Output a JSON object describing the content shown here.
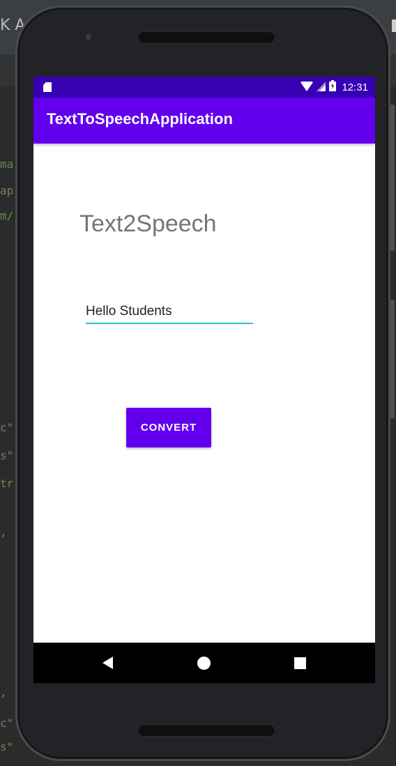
{
  "ide": {
    "top_text": "K A",
    "code_fragments": [
      "ma",
      "ap",
      "m/",
      "c\"",
      "s\"",
      "tr",
      ",",
      ",",
      "c\"",
      "s\""
    ]
  },
  "status_bar": {
    "time": "12:31",
    "icons": [
      "sd-card-icon",
      "wifi-icon",
      "signal-icon",
      "battery-icon"
    ]
  },
  "app_bar": {
    "title": "TextToSpeechApplication"
  },
  "main": {
    "heading": "Text2Speech",
    "input_value": "Hello Students",
    "convert_label": "CONVERT"
  },
  "nav_bar": {
    "icons": [
      "back-icon",
      "home-icon",
      "recent-apps-icon"
    ]
  },
  "colors": {
    "status_bar": "#3700b3",
    "primary": "#6200ee",
    "input_underline": "#26c6c6",
    "heading_text": "#757575"
  }
}
